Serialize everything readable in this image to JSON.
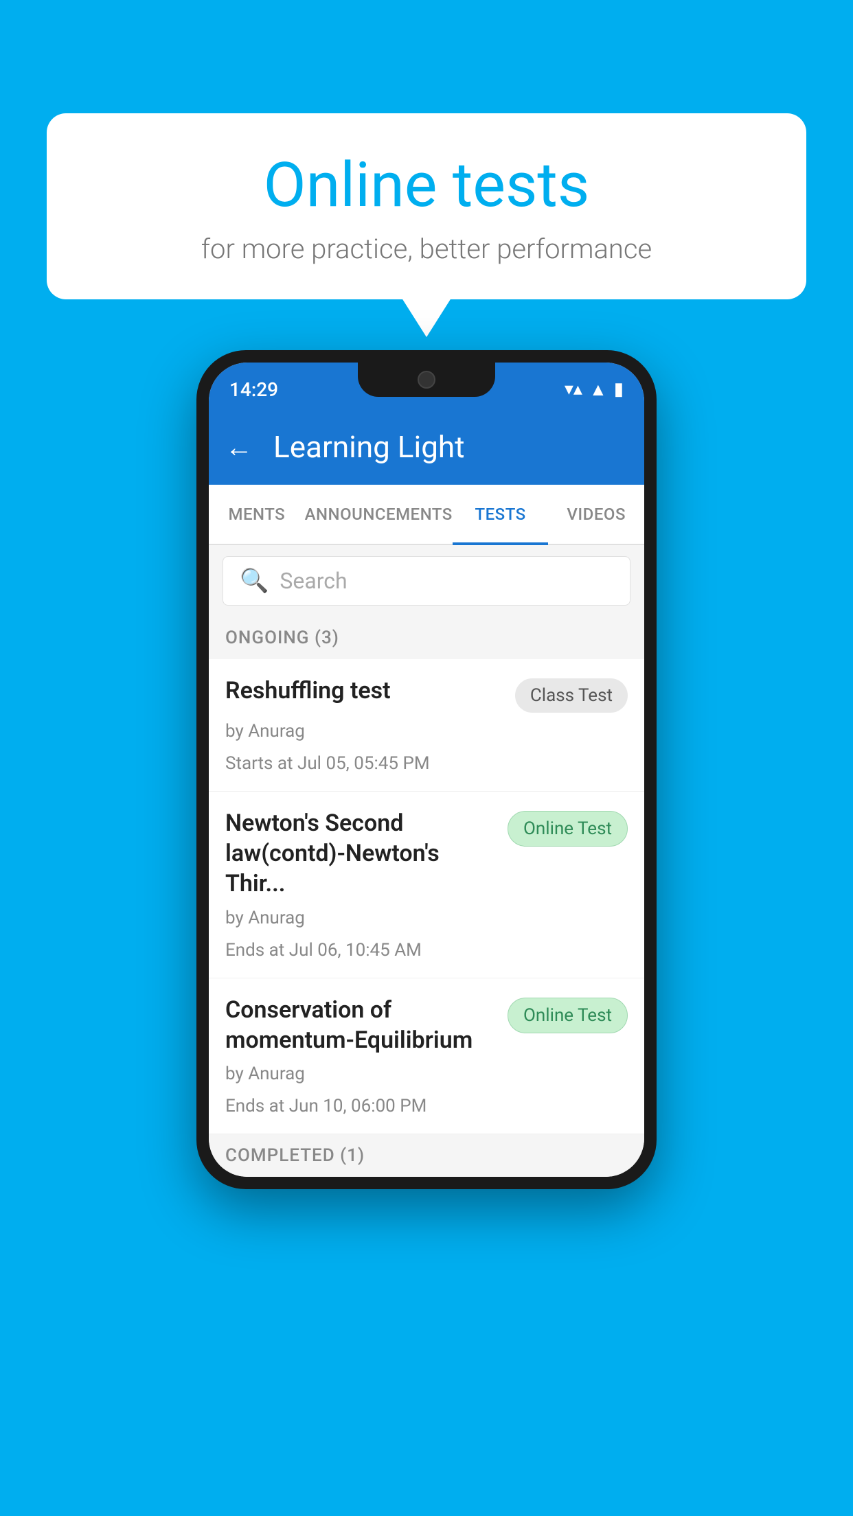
{
  "background": {
    "color": "#00AEEF"
  },
  "speech_bubble": {
    "title": "Online tests",
    "subtitle": "for more practice, better performance"
  },
  "phone": {
    "status_bar": {
      "time": "14:29",
      "wifi": "▼▲",
      "signal": "▲",
      "battery": "▮"
    },
    "app_bar": {
      "back_label": "←",
      "title": "Learning Light"
    },
    "tabs": [
      {
        "label": "MENTS",
        "active": false
      },
      {
        "label": "ANNOUNCEMENTS",
        "active": false
      },
      {
        "label": "TESTS",
        "active": true
      },
      {
        "label": "VIDEOS",
        "active": false
      }
    ],
    "search": {
      "placeholder": "Search"
    },
    "ongoing_section": {
      "header": "ONGOING (3)",
      "items": [
        {
          "name": "Reshuffling test",
          "badge": "Class Test",
          "badge_type": "class",
          "by": "by Anurag",
          "time_label": "Starts at  Jul 05, 05:45 PM"
        },
        {
          "name": "Newton's Second law(contd)-Newton's Thir...",
          "badge": "Online Test",
          "badge_type": "online",
          "by": "by Anurag",
          "time_label": "Ends at  Jul 06, 10:45 AM"
        },
        {
          "name": "Conservation of momentum-Equilibrium",
          "badge": "Online Test",
          "badge_type": "online",
          "by": "by Anurag",
          "time_label": "Ends at  Jun 10, 06:00 PM"
        }
      ]
    },
    "completed_section": {
      "header": "COMPLETED (1)"
    }
  }
}
